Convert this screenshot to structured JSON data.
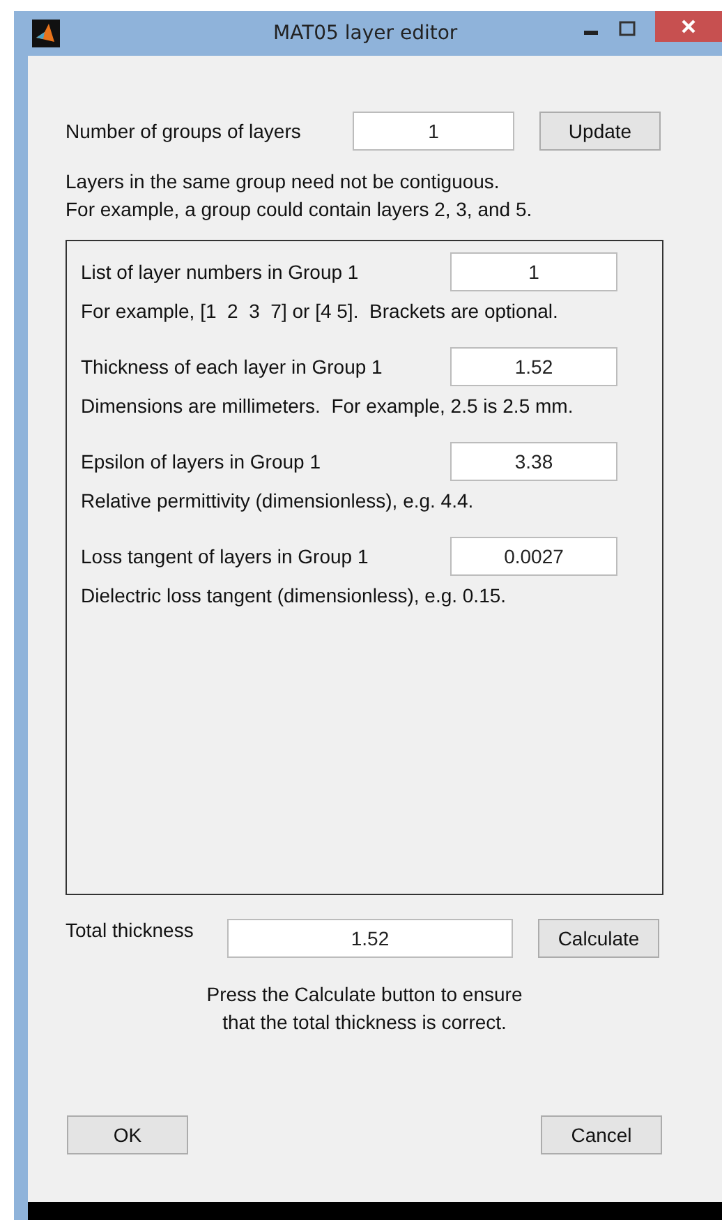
{
  "window": {
    "title": "MAT05 layer editor"
  },
  "groups_row": {
    "label": "Number of groups of layers",
    "value": "1",
    "button": "Update"
  },
  "intro": [
    "Layers in the same group need not be contiguous.",
    "For example, a group could contain layers 2, 3, and 5."
  ],
  "panel": {
    "fields": [
      {
        "label": "List of layer numbers in Group 1",
        "value": "1",
        "hint": "For example, [1  2  3  7] or [4 5].  Brackets are optional."
      },
      {
        "label": "Thickness of each layer in Group 1",
        "value": "1.52",
        "hint": "Dimensions are millimeters.  For example, 2.5 is 2.5 mm."
      },
      {
        "label": "Epsilon of layers in Group 1",
        "value": "3.38",
        "hint": "Relative permittivity (dimensionless), e.g. 4.4."
      },
      {
        "label": "Loss tangent of layers in Group 1",
        "value": "0.0027",
        "hint": "Dielectric loss tangent (dimensionless), e.g. 0.15."
      }
    ]
  },
  "total_row": {
    "label": "Total thickness",
    "value": "1.52",
    "button": "Calculate"
  },
  "note": [
    "Press the Calculate button to ensure",
    "that the total thickness is correct."
  ],
  "buttons": [
    "OK",
    "Cancel"
  ]
}
